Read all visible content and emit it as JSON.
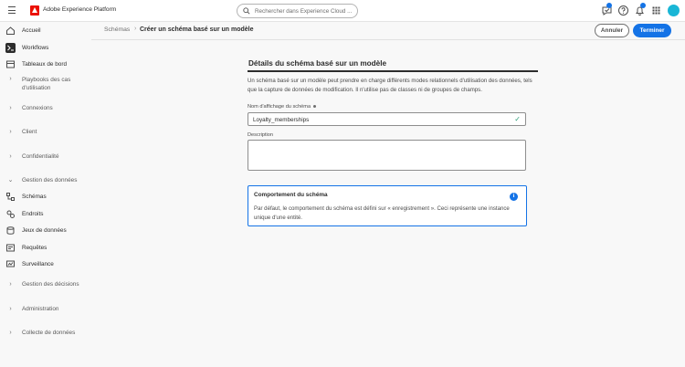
{
  "app": {
    "title": "Adobe Experience Platform"
  },
  "search": {
    "placeholder": "Rechercher dans Experience Cloud ..."
  },
  "topbar": {
    "icons": [
      "whats-new-icon",
      "help-icon",
      "notifications-icon",
      "apps-grid-icon",
      "avatar"
    ],
    "notification_count": ""
  },
  "sidebar": {
    "items": [
      {
        "label": "Accueil",
        "icon": "home-icon"
      },
      {
        "label": "Workflows",
        "icon": "workflows-icon",
        "active": true
      },
      {
        "label": "Tableaux de bord",
        "icon": "dashboards-icon"
      },
      {
        "label": "Playbooks des cas d'utilisation",
        "icon": "chevron-right-icon"
      },
      {
        "label": "Connexions",
        "icon": "chevron-right-icon"
      },
      {
        "label": "Client",
        "icon": "chevron-right-icon"
      },
      {
        "label": "Confidentialité",
        "icon": "chevron-right-icon"
      },
      {
        "label": "Gestion des données",
        "icon": "chevron-down-icon"
      },
      {
        "label": "Schémas",
        "icon": "schemas-icon"
      },
      {
        "label": "Endroits",
        "icon": "locations-icon"
      },
      {
        "label": "Jeux de données",
        "icon": "datasets-icon"
      },
      {
        "label": "Requêtes",
        "icon": "queries-icon"
      },
      {
        "label": "Surveillance",
        "icon": "monitoring-icon"
      },
      {
        "label": "Gestion des décisions",
        "icon": "chevron-right-icon"
      },
      {
        "label": "Administration",
        "icon": "chevron-right-icon"
      },
      {
        "label": "Collecte de données",
        "icon": "chevron-right-icon"
      }
    ]
  },
  "breadcrumb": {
    "parent": "Schémas",
    "separator": "›",
    "current": "Créer un schéma basé sur un modèle"
  },
  "actions": {
    "cancel": "Annuler",
    "finish": "Terminer"
  },
  "form": {
    "title": "Détails du schéma basé sur un modèle",
    "description": "Un schéma basé sur un modèle peut prendre en charge différents modes relationnels d'utilisation des données, tels que la capture de données de modification. Il n'utilise pas de classes ni de groupes de champs.",
    "name_label": "Nom d'affichage du schéma",
    "name_value": "Loyalty_memberships",
    "description_label": "Description",
    "description_value": ""
  },
  "info": {
    "title": "Comportement du schéma",
    "text": "Par défaut, le comportement du schéma est défini sur « enregistrement ». Ceci représente une instance unique d'une entité."
  },
  "colors": {
    "accent": "#1473e6",
    "brand": "#eb1000",
    "valid": "#2d9d78"
  }
}
